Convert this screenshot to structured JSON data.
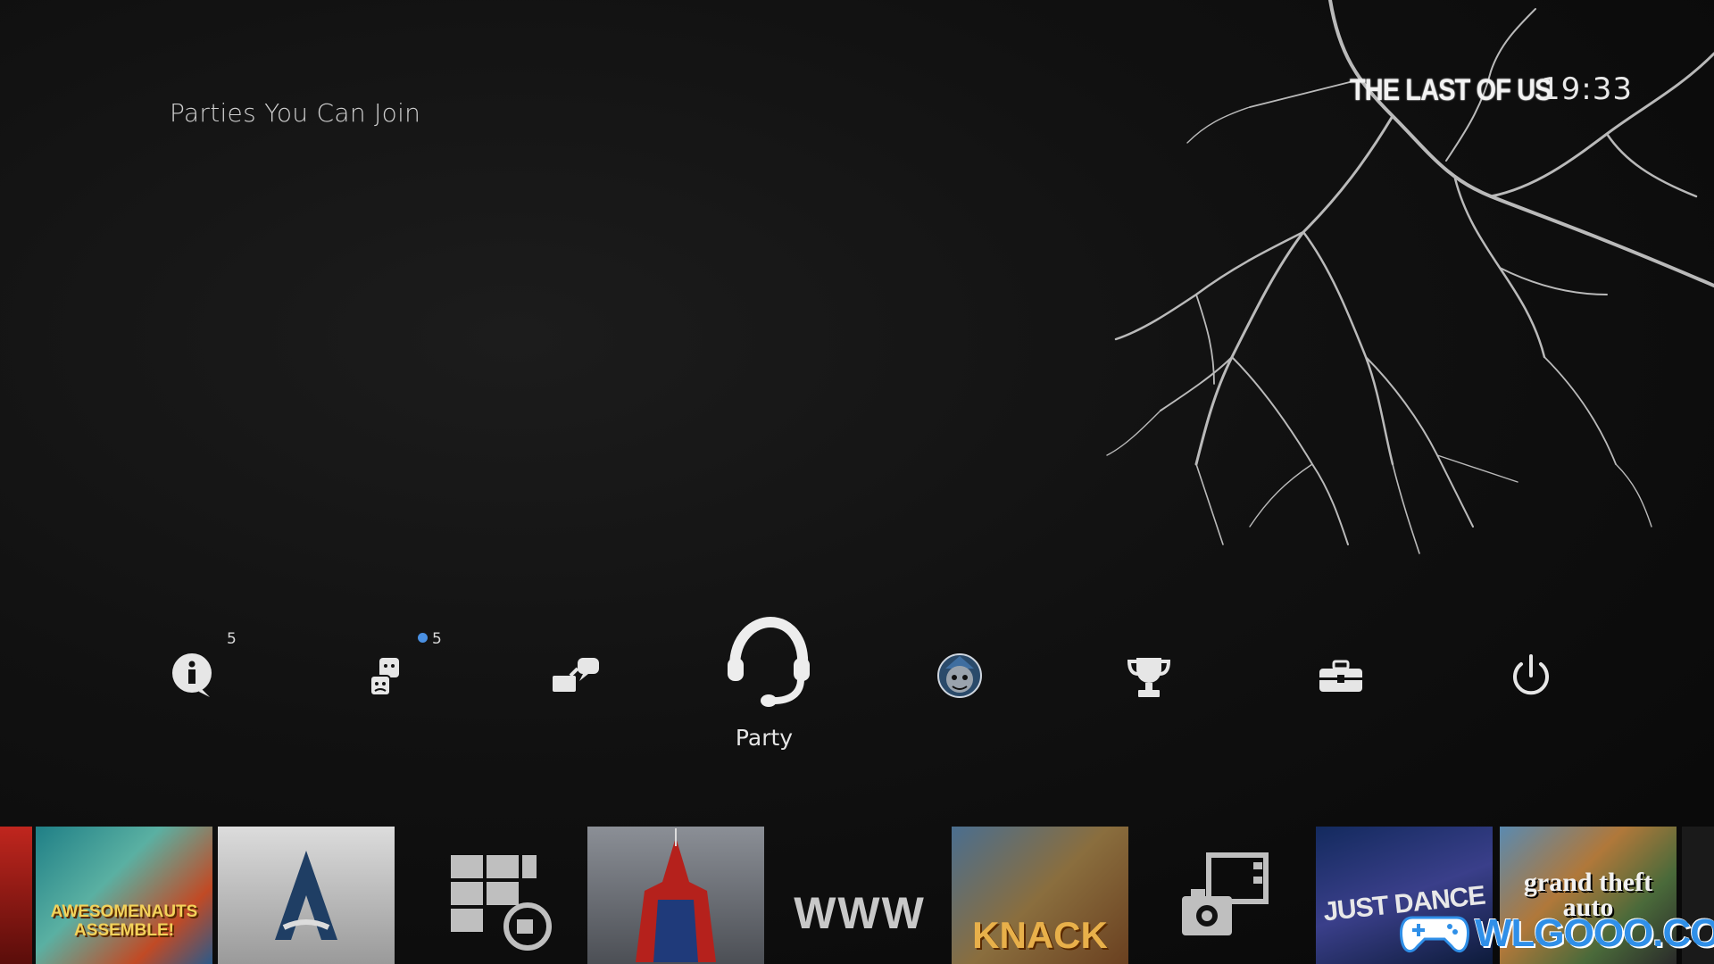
{
  "header": {
    "section_title": "Parties You Can Join",
    "game_title": "THE LAST OF US",
    "clock": "19:33"
  },
  "function_bar": {
    "selected_label": "Party",
    "items": [
      {
        "icon": "notifications-icon",
        "badge": "5"
      },
      {
        "icon": "friends-icon",
        "badge": "5",
        "online_dot": true
      },
      {
        "icon": "messages-icon",
        "badge": ""
      },
      {
        "icon": "party-headset-icon",
        "badge": "",
        "selected": true
      },
      {
        "icon": "profile-avatar-icon",
        "badge": ""
      },
      {
        "icon": "trophy-icon",
        "badge": ""
      },
      {
        "icon": "settings-toolbox-icon",
        "badge": ""
      },
      {
        "icon": "power-icon",
        "badge": ""
      }
    ]
  },
  "content_shelf": {
    "tiles": [
      {
        "name": "Awesomenauts Assemble!",
        "text": "AWESOMENAUTS ASSEMBLE!"
      },
      {
        "name": "Assassin's Creed",
        "text": ""
      },
      {
        "name": "TV & Video",
        "text": ""
      },
      {
        "name": "The Amazing Spider-Man",
        "text": ""
      },
      {
        "name": "Internet Browser",
        "text": "WWW"
      },
      {
        "name": "Knack",
        "text": "KNACK"
      },
      {
        "name": "Capture Gallery",
        "text": ""
      },
      {
        "name": "Just Dance",
        "text": "JUST DANCE"
      },
      {
        "name": "Grand Theft Auto V",
        "text": "grand theft auto"
      }
    ]
  },
  "watermark": {
    "text": "WLGOOO.COM"
  },
  "colors": {
    "accent_dot": "#4a90e2",
    "watermark": "#2f8fe8"
  }
}
